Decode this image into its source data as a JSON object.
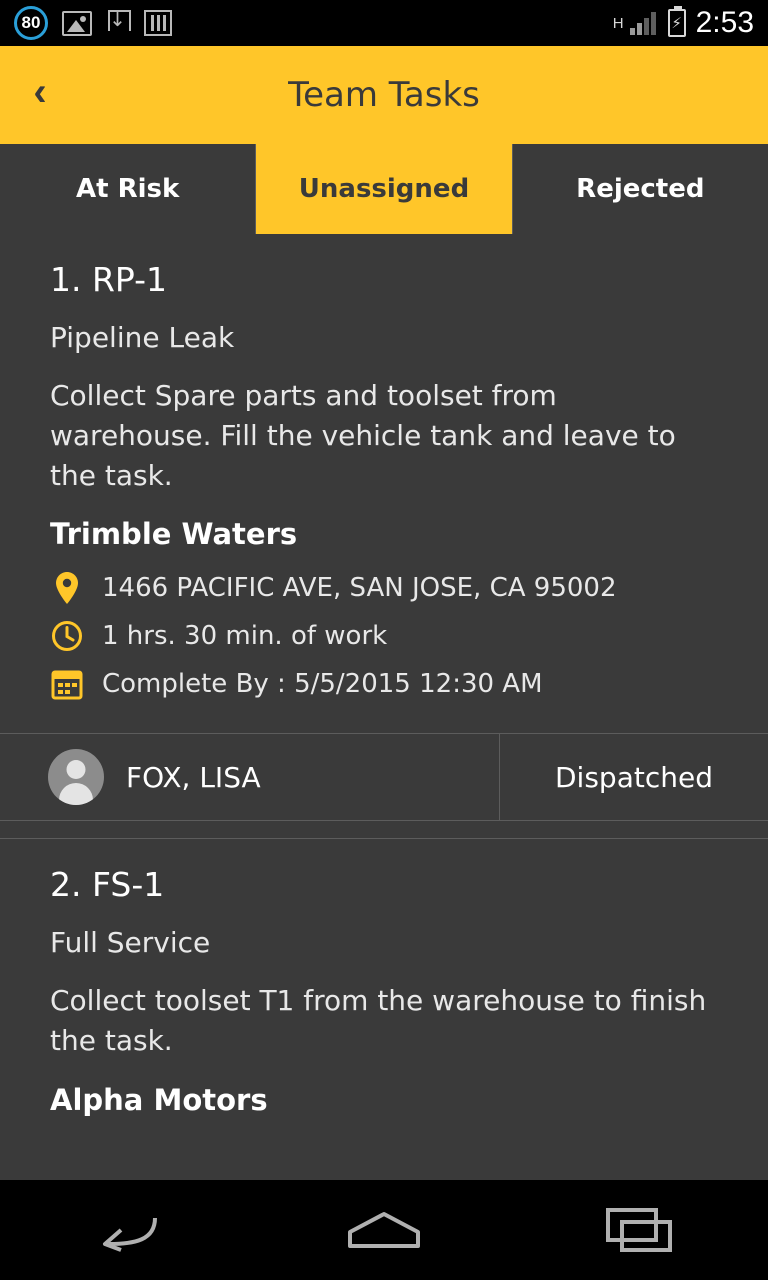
{
  "status_bar": {
    "notification_badge": "80",
    "icons": [
      "photos-icon",
      "download-icon",
      "bars-icon"
    ],
    "network_type": "H",
    "signal_icon": "signal-icon",
    "battery_icon": "battery-charging-icon",
    "time": "2:53"
  },
  "app_bar": {
    "back_label": "‹",
    "title": "Team Tasks"
  },
  "tabs": [
    {
      "label": "At Risk",
      "active": false
    },
    {
      "label": "Unassigned",
      "active": true
    },
    {
      "label": "Rejected",
      "active": false
    }
  ],
  "tasks": [
    {
      "title": "1. RP-1",
      "type": "Pipeline Leak",
      "description": "Collect Spare parts and toolset from warehouse. Fill the vehicle tank and leave to the task.",
      "customer": "Trimble Waters",
      "address": "1466 PACIFIC AVE, SAN JOSE, CA 95002",
      "duration": "1 hrs. 30 min. of work",
      "complete_by": "Complete By : 5/5/2015 12:30 AM",
      "assignee": "FOX, LISA",
      "status": "Dispatched"
    },
    {
      "title": "2. FS-1",
      "type": "Full Service",
      "description": "Collect toolset T1 from the warehouse to finish the task.",
      "customer": "Alpha Motors"
    }
  ],
  "nav_bar": {
    "back": "back-nav-icon",
    "home": "home-nav-icon",
    "recents": "recents-nav-icon"
  },
  "colors": {
    "accent": "#ffc629",
    "background": "#3a3a3a",
    "status_bar": "#000000",
    "text": "#ffffff"
  }
}
